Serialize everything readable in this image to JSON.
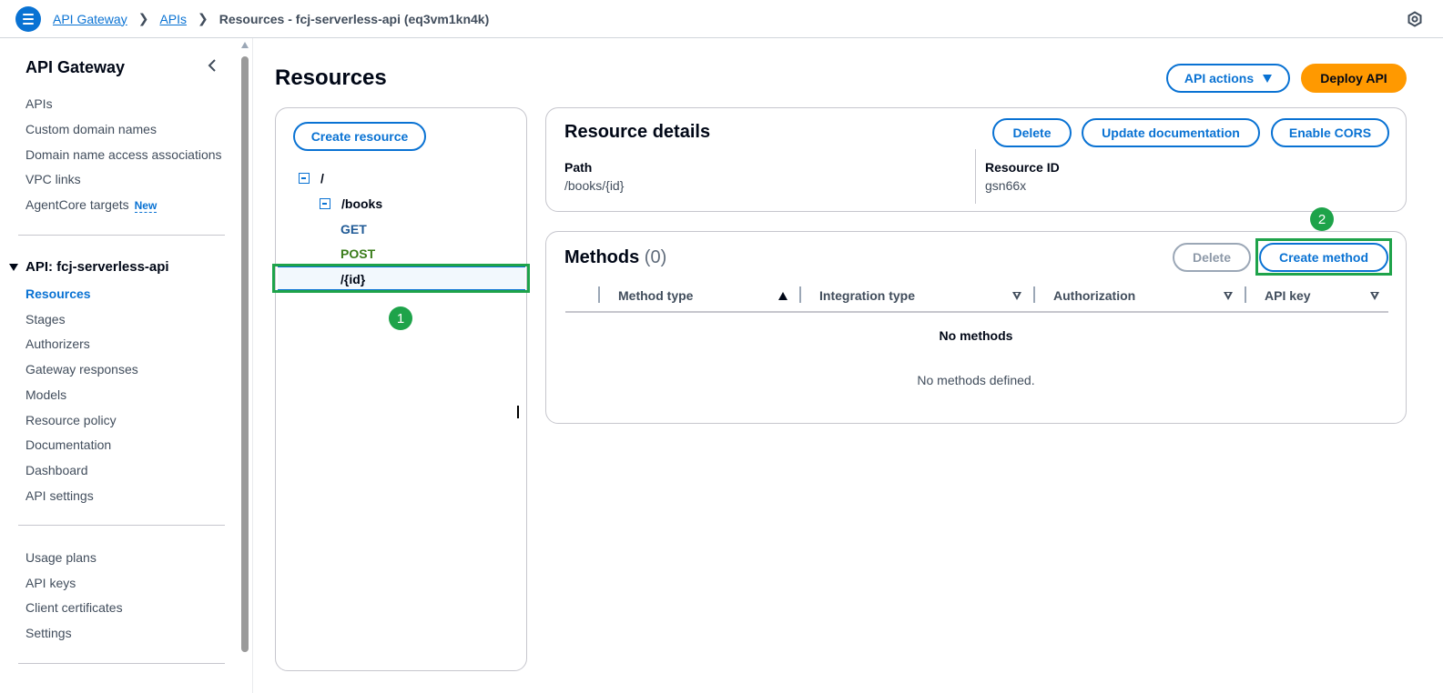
{
  "topbar": {
    "breadcrumbs": [
      "API Gateway",
      "APIs"
    ],
    "current": "Resources - fcj-serverless-api (eq3vm1kn4k)",
    "menu_icon": "hamburger-menu-icon",
    "settings_icon": "settings-icon"
  },
  "sidebar": {
    "title": "API Gateway",
    "top_items": [
      "APIs",
      "Custom domain names",
      "Domain name access associations",
      "VPC links",
      "AgentCore targets"
    ],
    "new_badge": "New",
    "section": "API: fcj-serverless-api",
    "api_items": [
      "Resources",
      "Stages",
      "Authorizers",
      "Gateway responses",
      "Models",
      "Resource policy",
      "Documentation",
      "Dashboard",
      "API settings"
    ],
    "bottom_items": [
      "Usage plans",
      "API keys",
      "Client certificates",
      "Settings"
    ]
  },
  "main": {
    "title": "Resources",
    "api_actions": "API actions",
    "deploy_api": "Deploy API",
    "create_resource": "Create resource",
    "tree": {
      "root": "/",
      "books": "/books",
      "get": "GET",
      "post": "POST",
      "id": "/{id}"
    },
    "resource_details": {
      "title": "Resource details",
      "delete": "Delete",
      "update_docs": "Update documentation",
      "enable_cors": "Enable CORS",
      "path_label": "Path",
      "path_value": "/books/{id}",
      "id_label": "Resource ID",
      "id_value": "gsn66x"
    },
    "methods": {
      "title": "Methods",
      "count": "(0)",
      "delete": "Delete",
      "create_method": "Create method",
      "columns": [
        "Method type",
        "Integration type",
        "Authorization",
        "API key"
      ],
      "empty_title": "No methods",
      "empty_desc": "No methods defined."
    }
  },
  "annotations": {
    "step1": "1",
    "step2": "2",
    "highlight_color": "#1ea34a"
  },
  "colors": {
    "link": "#0972d3",
    "primary": "#ff9900"
  }
}
